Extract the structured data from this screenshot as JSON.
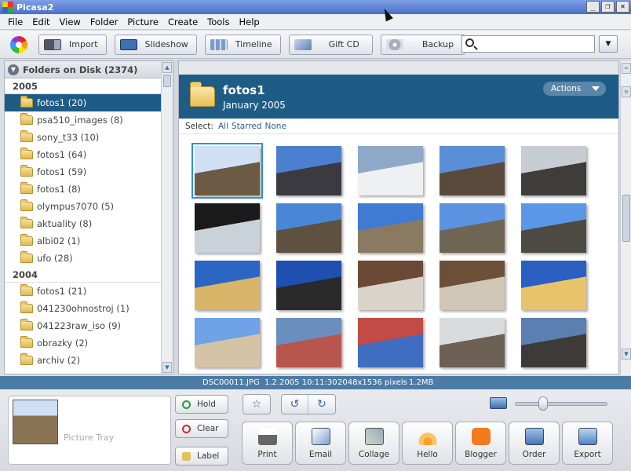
{
  "window": {
    "title": "Picasa2",
    "min": "_",
    "max": "❐",
    "close": "✕"
  },
  "menu": [
    "File",
    "Edit",
    "View",
    "Folder",
    "Picture",
    "Create",
    "Tools",
    "Help"
  ],
  "toolbar": {
    "import": "Import",
    "slideshow": "Slideshow",
    "timeline": "Timeline",
    "giftcd": "Gift CD",
    "backup": "Backup",
    "search_value": "",
    "dropdown": "▼"
  },
  "sidebar": {
    "header": "Folders on Disk (2374)",
    "groups": [
      {
        "year": "2005",
        "folders": [
          "fotos1 (20)",
          "psa510_images (8)",
          "sony_t33 (10)",
          "fotos1 (64)",
          "fotos1 (59)",
          "fotos1 (8)",
          "olympus7070 (5)",
          "aktuality (8)",
          "albi02 (1)",
          "ufo (28)"
        ]
      },
      {
        "year": "2004",
        "folders": [
          "fotos1 (21)",
          "041230ohnostroj (1)",
          "041223raw_iso (9)",
          "obrazky (2)",
          "archiv (2)"
        ]
      }
    ]
  },
  "album": {
    "name": "fotos1",
    "date": "January 2005",
    "actions": "Actions",
    "select_label": "Select:",
    "select_all": "All",
    "select_starred": "Starred",
    "select_none": "None"
  },
  "thumbnails": [
    {
      "c1": "#cfe0f5",
      "c2": "#6c5a44"
    },
    {
      "c1": "#4d7fd1",
      "c2": "#3a3a40"
    },
    {
      "c1": "#8fa9c9",
      "c2": "#eef0f2"
    },
    {
      "c1": "#5a8ed6",
      "c2": "#5a4a3c"
    },
    {
      "c1": "#c8ccd3",
      "c2": "#3f3d3a"
    },
    {
      "c1": "#1a1a1a",
      "c2": "#c9d2d9"
    },
    {
      "c1": "#4a86d8",
      "c2": "#5e513f"
    },
    {
      "c1": "#3f7ad3",
      "c2": "#8a7a62"
    },
    {
      "c1": "#5b93e0",
      "c2": "#6f6554"
    },
    {
      "c1": "#5a97e6",
      "c2": "#4d4a44"
    },
    {
      "c1": "#2d66c2",
      "c2": "#d9b56a"
    },
    {
      "c1": "#1d50b0",
      "c2": "#2a2a2a"
    },
    {
      "c1": "#6a4a35",
      "c2": "#d9d4ca"
    },
    {
      "c1": "#6d5038",
      "c2": "#cfc6b6"
    },
    {
      "c1": "#2c5fc2",
      "c2": "#e8c36b"
    },
    {
      "c1": "#6fa2e6",
      "c2": "#d5c3a5"
    },
    {
      "c1": "#6a8ebd",
      "c2": "#b8554c"
    },
    {
      "c1": "#c24b45",
      "c2": "#3f6ec0"
    },
    {
      "c1": "#d8dcdf",
      "c2": "#6c6154"
    },
    {
      "c1": "#5a7fb0",
      "c2": "#3d3a38"
    }
  ],
  "status": {
    "filename": "DSC00011.JPG",
    "datetime": "1.2.2005 10:11:30",
    "dimensions": "2048x1536 pixels",
    "size": "1.2MB"
  },
  "tray": {
    "label": "Picture Tray",
    "hold": "Hold",
    "clear": "Clear",
    "label_btn": "Label"
  },
  "actions": [
    "Print",
    "Email",
    "Collage",
    "Hello",
    "Blogger",
    "Order",
    "Export"
  ],
  "colors": {
    "accent": "#1e5b85",
    "statusbar": "#4c7ba6"
  }
}
